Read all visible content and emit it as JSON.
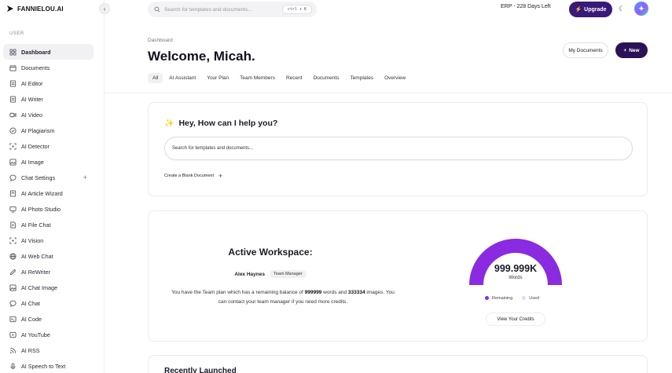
{
  "brand": {
    "name": "FANNIELOU.AI"
  },
  "sidebar": {
    "section_label": "USER",
    "items": [
      {
        "label": "Dashboard",
        "icon": "grid-icon",
        "active": true
      },
      {
        "label": "Documents",
        "icon": "folder-icon"
      },
      {
        "label": "AI Editor",
        "icon": "document-icon"
      },
      {
        "label": "AI Writer",
        "icon": "document-icon"
      },
      {
        "label": "AI Video",
        "icon": "video-icon"
      },
      {
        "label": "AI Plagiarism",
        "icon": "shield-check-icon"
      },
      {
        "label": "AI Detector",
        "icon": "scan-icon"
      },
      {
        "label": "AI Image",
        "icon": "image-icon"
      },
      {
        "label": "Chat Settings",
        "icon": "chat-bubble-icon",
        "has_plus": true
      },
      {
        "label": "AI Article Wizard",
        "icon": "wizard-icon"
      },
      {
        "label": "AI Photo Studio",
        "icon": "monitor-icon"
      },
      {
        "label": "AI File Chat",
        "icon": "file-chat-icon"
      },
      {
        "label": "AI Vision",
        "icon": "scan-icon"
      },
      {
        "label": "AI Web Chat",
        "icon": "globe-icon"
      },
      {
        "label": "AI ReWriter",
        "icon": "pen-icon"
      },
      {
        "label": "AI Chat Image",
        "icon": "image-icon"
      },
      {
        "label": "AI Chat",
        "icon": "chat-bubble-icon"
      },
      {
        "label": "AI Code",
        "icon": "terminal-icon"
      },
      {
        "label": "AI YouTube",
        "icon": "play-icon"
      },
      {
        "label": "AI RSS",
        "icon": "rss-icon"
      },
      {
        "label": "AI Speech to Text",
        "icon": "microphone-icon"
      }
    ],
    "plus_label": "+"
  },
  "topbar": {
    "search_placeholder": "Search for templates and documents...",
    "shortcut": "ctrl + K",
    "erp_label": "ERP - 228 Days Left",
    "upgrade_label": "Upgrade"
  },
  "header": {
    "breadcrumb": "Dashboard",
    "title": "Welcome, Micah.",
    "my_documents_label": "My Documents",
    "new_label": "New",
    "tabs": [
      "All",
      "AI Assistant",
      "Your Plan",
      "Team Members",
      "Recent",
      "Documents",
      "Templates",
      "Overview"
    ]
  },
  "help": {
    "title": "Hey, How can I help you?",
    "search_placeholder": "Search for templates and documents...",
    "blank_doc_label": "Create a Blank Document",
    "plus": "+"
  },
  "workspace": {
    "title": "Active Workspace:",
    "user_name": "Alex Haynes",
    "role": "Team Manager",
    "desc_prefix": "You have the Team plan which has a remaining balance of ",
    "words_balance": "999999",
    "desc_mid": " words and ",
    "images_balance": "333334",
    "desc_suffix": " images. You can contact your team manager if you need more credits.",
    "gauge_value": "999.999K",
    "gauge_unit": "Words",
    "remaining_fraction": 1.0,
    "legend_remaining": "Remaining",
    "legend_used": "Used",
    "credits_button": "View Your Credits",
    "colors": {
      "remaining": "#8a2be2",
      "used": "#e8d8f8"
    }
  },
  "recent": {
    "title": "Recently Launched"
  }
}
